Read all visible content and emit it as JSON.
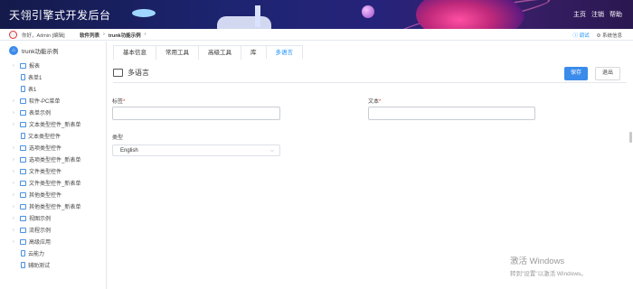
{
  "header": {
    "title": "天翎引擎式开发后台",
    "links": [
      "主页",
      "注销",
      "帮助"
    ]
  },
  "crumbbar": {
    "greeting": "你好，Admin [编辑]",
    "crumbs": [
      "软件列表",
      "trunk功能示例"
    ],
    "debug": "调试",
    "sysinfo": "系统信息"
  },
  "sidebar": {
    "root_label": "trunk功能示例",
    "items": [
      {
        "label": "报表",
        "type": "folder"
      },
      {
        "label": "表单1",
        "type": "doc"
      },
      {
        "label": "表1",
        "type": "doc"
      },
      {
        "label": "软件-PC菜单",
        "type": "folder"
      },
      {
        "label": "表单示例",
        "type": "folder"
      },
      {
        "label": "文本类型控件_新表单",
        "type": "folder"
      },
      {
        "label": "文本类型控件",
        "type": "doc"
      },
      {
        "label": "选项类型控件",
        "type": "folder"
      },
      {
        "label": "选项类型控件_新表单",
        "type": "folder"
      },
      {
        "label": "文件类型控件",
        "type": "folder"
      },
      {
        "label": "文件类型控件_新表单",
        "type": "folder"
      },
      {
        "label": "其他类型控件",
        "type": "folder"
      },
      {
        "label": "其他类型控件_新表单",
        "type": "folder"
      },
      {
        "label": "视图示例",
        "type": "folder"
      },
      {
        "label": "流程示例",
        "type": "folder"
      },
      {
        "label": "高级应用",
        "type": "folder"
      },
      {
        "label": "云能力",
        "type": "doc"
      },
      {
        "label": "辅助测试",
        "type": "doc"
      }
    ]
  },
  "tabs": [
    "基本信息",
    "常用工具",
    "高级工具",
    "库",
    "多语言"
  ],
  "active_tab": "多语言",
  "section": {
    "title": "多语言",
    "save": "保存",
    "exit": "退出"
  },
  "form": {
    "label_field": "标签",
    "text_field": "文本",
    "type_field": "类型",
    "type_value": "English",
    "required_mark": "*"
  },
  "watermark": {
    "line1": "激活 Windows",
    "line2": "转到\"设置\"以激活 Windows。"
  },
  "colors": {
    "accent": "#3b8beb",
    "active_tab": "#1890ff",
    "required": "#e33333"
  }
}
